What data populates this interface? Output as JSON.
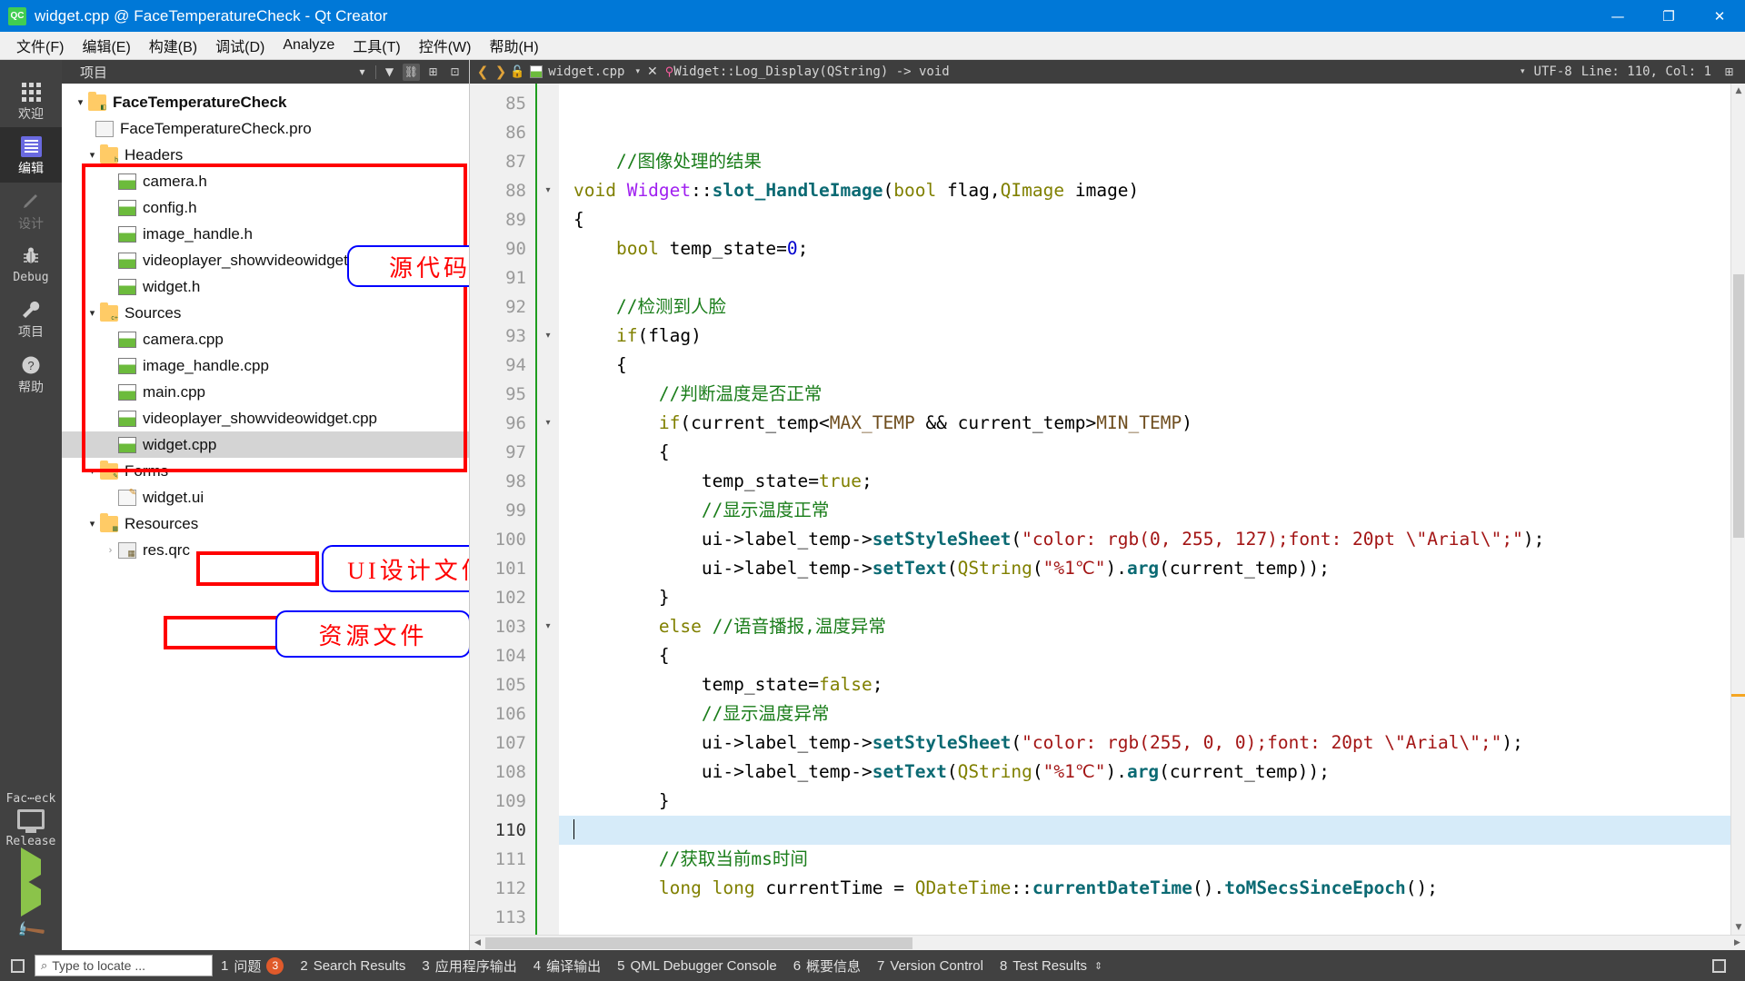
{
  "window": {
    "app_icon": "qt-creator-icon",
    "title": "widget.cpp @ FaceTemperatureCheck - Qt Creator",
    "minimize": "—",
    "maximize": "❐",
    "close": "✕"
  },
  "menubar": {
    "items": [
      {
        "label": "文件(F)",
        "name": "menu-file"
      },
      {
        "label": "编辑(E)",
        "name": "menu-edit"
      },
      {
        "label": "构建(B)",
        "name": "menu-build"
      },
      {
        "label": "调试(D)",
        "name": "menu-debug"
      },
      {
        "label": "Analyze",
        "name": "menu-analyze"
      },
      {
        "label": "工具(T)",
        "name": "menu-tools"
      },
      {
        "label": "控件(W)",
        "name": "menu-window"
      },
      {
        "label": "帮助(H)",
        "name": "menu-help"
      }
    ]
  },
  "modebar": {
    "modes": [
      {
        "label": "欢迎",
        "icon": "grid-icon",
        "state": "normal"
      },
      {
        "label": "编辑",
        "icon": "document-lines-icon",
        "state": "active"
      },
      {
        "label": "设计",
        "icon": "pencil-icon",
        "state": "disabled"
      },
      {
        "label": "Debug",
        "icon": "bug-icon",
        "state": "normal"
      },
      {
        "label": "项目",
        "icon": "wrench-icon",
        "state": "normal"
      },
      {
        "label": "帮助",
        "icon": "question-circle-icon",
        "state": "normal"
      }
    ],
    "kit": {
      "project": "Fac⋯eck",
      "build_config": "Release",
      "run_icon": "play-icon",
      "debug_icon": "play-debug-icon",
      "build_icon": "hammer-icon"
    }
  },
  "sidebar": {
    "header": {
      "title": "项目",
      "filter_caret": "▾",
      "filter_icon": "filter-icon",
      "link_icon": "link-icon",
      "split_icon": "split-icon",
      "close_icon": "close-panel-icon"
    },
    "tree": [
      {
        "label": "FaceTemperatureCheck",
        "icon": "project-folder-icon",
        "arrow": "▾",
        "indent": 0,
        "bold": true,
        "selected": false
      },
      {
        "label": "FaceTemperatureCheck.pro",
        "icon": "pro-file-icon",
        "arrow": "",
        "indent": 1,
        "bold": false,
        "selected": false
      },
      {
        "label": "Headers",
        "icon": "folder-headers-icon",
        "arrow": "▾",
        "indent": 1,
        "bold": false,
        "selected": false
      },
      {
        "label": "camera.h",
        "icon": "source-file-icon",
        "arrow": "",
        "indent": 2,
        "bold": false,
        "selected": false
      },
      {
        "label": "config.h",
        "icon": "source-file-icon",
        "arrow": "",
        "indent": 2,
        "bold": false,
        "selected": false
      },
      {
        "label": "image_handle.h",
        "icon": "source-file-icon",
        "arrow": "",
        "indent": 2,
        "bold": false,
        "selected": false
      },
      {
        "label": "videoplayer_showvideowidget.h",
        "icon": "source-file-icon",
        "arrow": "",
        "indent": 2,
        "bold": false,
        "selected": false
      },
      {
        "label": "widget.h",
        "icon": "source-file-icon",
        "arrow": "",
        "indent": 2,
        "bold": false,
        "selected": false
      },
      {
        "label": "Sources",
        "icon": "folder-sources-icon",
        "arrow": "▾",
        "indent": 1,
        "bold": false,
        "selected": false
      },
      {
        "label": "camera.cpp",
        "icon": "source-file-icon",
        "arrow": "",
        "indent": 2,
        "bold": false,
        "selected": false
      },
      {
        "label": "image_handle.cpp",
        "icon": "source-file-icon",
        "arrow": "",
        "indent": 2,
        "bold": false,
        "selected": false
      },
      {
        "label": "main.cpp",
        "icon": "source-file-icon",
        "arrow": "",
        "indent": 2,
        "bold": false,
        "selected": false
      },
      {
        "label": "videoplayer_showvideowidget.cpp",
        "icon": "source-file-icon",
        "arrow": "",
        "indent": 2,
        "bold": false,
        "selected": false
      },
      {
        "label": "widget.cpp",
        "icon": "source-file-icon",
        "arrow": "",
        "indent": 2,
        "bold": false,
        "selected": true
      },
      {
        "label": "Forms",
        "icon": "folder-forms-icon",
        "arrow": "▾",
        "indent": 1,
        "bold": false,
        "selected": false
      },
      {
        "label": "widget.ui",
        "icon": "ui-file-icon",
        "arrow": "",
        "indent": 2,
        "bold": false,
        "selected": false
      },
      {
        "label": "Resources",
        "icon": "folder-resources-icon",
        "arrow": "▾",
        "indent": 1,
        "bold": false,
        "selected": false
      },
      {
        "label": "res.qrc",
        "icon": "qrc-file-icon",
        "arrow": "›",
        "indent": 2,
        "bold": false,
        "selected": false
      }
    ],
    "annotations": [
      {
        "text": "源代码",
        "name": "annotation-source-code"
      },
      {
        "text": "UI设计文件",
        "name": "annotation-ui-design-file"
      },
      {
        "text": "资源文件",
        "name": "annotation-resource-file"
      }
    ]
  },
  "editor": {
    "nav_back": "❮",
    "nav_forward": "❯",
    "lock_icon": "lock-icon",
    "file_icon": "cpp-file-icon",
    "filename": "widget.cpp",
    "file_caret": "▾",
    "close_label": "✕",
    "symbol_icon": "symbol-pin-icon",
    "symbol": "Widget::Log_Display(QString) -> void",
    "symbol_caret": "▾",
    "encoding": "UTF-8",
    "line_col": "Line: 110, Col: 1",
    "split_icon": "split-editor-icon",
    "first_line": 85,
    "cursor_line": 110,
    "lines": [
      {
        "n": 85,
        "fold": "",
        "tokens": []
      },
      {
        "n": 86,
        "fold": "",
        "tokens": []
      },
      {
        "n": 87,
        "fold": "",
        "tokens": [
          {
            "t": "    ",
            "c": "k-op"
          },
          {
            "t": "//图像处理的结果",
            "c": "k-cmt"
          }
        ]
      },
      {
        "n": 88,
        "fold": "▾",
        "tokens": [
          {
            "t": "void ",
            "c": "k-key"
          },
          {
            "t": "Widget",
            "c": "k-cls"
          },
          {
            "t": "::",
            "c": "k-op"
          },
          {
            "t": "slot_HandleImage",
            "c": "k-fn"
          },
          {
            "t": "(",
            "c": "k-op"
          },
          {
            "t": "bool",
            "c": "k-key"
          },
          {
            "t": " flag,",
            "c": "k-op"
          },
          {
            "t": "QImage",
            "c": "k-key"
          },
          {
            "t": " image)",
            "c": "k-op"
          }
        ]
      },
      {
        "n": 89,
        "fold": "",
        "tokens": [
          {
            "t": "{",
            "c": "k-op"
          }
        ]
      },
      {
        "n": 90,
        "fold": "",
        "tokens": [
          {
            "t": "    ",
            "c": "k-op"
          },
          {
            "t": "bool",
            "c": "k-key"
          },
          {
            "t": " temp_state=",
            "c": "k-op"
          },
          {
            "t": "0",
            "c": "k-num"
          },
          {
            "t": ";",
            "c": "k-op"
          }
        ]
      },
      {
        "n": 91,
        "fold": "",
        "tokens": []
      },
      {
        "n": 92,
        "fold": "",
        "tokens": [
          {
            "t": "    ",
            "c": "k-op"
          },
          {
            "t": "//检测到人脸",
            "c": "k-cmt"
          }
        ]
      },
      {
        "n": 93,
        "fold": "▾",
        "tokens": [
          {
            "t": "    ",
            "c": "k-op"
          },
          {
            "t": "if",
            "c": "k-key"
          },
          {
            "t": "(flag)",
            "c": "k-op"
          }
        ]
      },
      {
        "n": 94,
        "fold": "",
        "tokens": [
          {
            "t": "    {",
            "c": "k-op"
          }
        ]
      },
      {
        "n": 95,
        "fold": "",
        "tokens": [
          {
            "t": "        ",
            "c": "k-op"
          },
          {
            "t": "//判断温度是否正常",
            "c": "k-cmt"
          }
        ]
      },
      {
        "n": 96,
        "fold": "▾",
        "tokens": [
          {
            "t": "        ",
            "c": "k-op"
          },
          {
            "t": "if",
            "c": "k-key"
          },
          {
            "t": "(current_temp<",
            "c": "k-op"
          },
          {
            "t": "MAX_TEMP",
            "c": "k-mac"
          },
          {
            "t": " && current_temp>",
            "c": "k-op"
          },
          {
            "t": "MIN_TEMP",
            "c": "k-mac"
          },
          {
            "t": ")",
            "c": "k-op"
          }
        ]
      },
      {
        "n": 97,
        "fold": "",
        "tokens": [
          {
            "t": "        {",
            "c": "k-op"
          }
        ]
      },
      {
        "n": 98,
        "fold": "",
        "tokens": [
          {
            "t": "            temp_state=",
            "c": "k-op"
          },
          {
            "t": "true",
            "c": "k-key"
          },
          {
            "t": ";",
            "c": "k-op"
          }
        ]
      },
      {
        "n": 99,
        "fold": "",
        "tokens": [
          {
            "t": "            ",
            "c": "k-op"
          },
          {
            "t": "//显示温度正常",
            "c": "k-cmt"
          }
        ]
      },
      {
        "n": 100,
        "fold": "",
        "tokens": [
          {
            "t": "            ui->label_temp->",
            "c": "k-op"
          },
          {
            "t": "setStyleSheet",
            "c": "k-fn"
          },
          {
            "t": "(",
            "c": "k-op"
          },
          {
            "t": "\"color: rgb(0, 255, 127);font: 20pt \\\"Arial\\\";\"",
            "c": "k-str"
          },
          {
            "t": ");",
            "c": "k-op"
          }
        ]
      },
      {
        "n": 101,
        "fold": "",
        "tokens": [
          {
            "t": "            ui->label_temp->",
            "c": "k-op"
          },
          {
            "t": "setText",
            "c": "k-fn"
          },
          {
            "t": "(",
            "c": "k-op"
          },
          {
            "t": "QString",
            "c": "k-key"
          },
          {
            "t": "(",
            "c": "k-op"
          },
          {
            "t": "\"%1℃\"",
            "c": "k-str"
          },
          {
            "t": ").",
            "c": "k-op"
          },
          {
            "t": "arg",
            "c": "k-fn"
          },
          {
            "t": "(current_temp));",
            "c": "k-op"
          }
        ]
      },
      {
        "n": 102,
        "fold": "",
        "tokens": [
          {
            "t": "        }",
            "c": "k-op"
          }
        ]
      },
      {
        "n": 103,
        "fold": "▾",
        "tokens": [
          {
            "t": "        ",
            "c": "k-op"
          },
          {
            "t": "else",
            "c": "k-key"
          },
          {
            "t": " ",
            "c": "k-op"
          },
          {
            "t": "//语音播报,温度异常",
            "c": "k-cmt"
          }
        ]
      },
      {
        "n": 104,
        "fold": "",
        "tokens": [
          {
            "t": "        {",
            "c": "k-op"
          }
        ]
      },
      {
        "n": 105,
        "fold": "",
        "tokens": [
          {
            "t": "            temp_state=",
            "c": "k-op"
          },
          {
            "t": "false",
            "c": "k-key"
          },
          {
            "t": ";",
            "c": "k-op"
          }
        ]
      },
      {
        "n": 106,
        "fold": "",
        "tokens": [
          {
            "t": "            ",
            "c": "k-op"
          },
          {
            "t": "//显示温度异常",
            "c": "k-cmt"
          }
        ]
      },
      {
        "n": 107,
        "fold": "",
        "tokens": [
          {
            "t": "            ui->label_temp->",
            "c": "k-op"
          },
          {
            "t": "setStyleSheet",
            "c": "k-fn"
          },
          {
            "t": "(",
            "c": "k-op"
          },
          {
            "t": "\"color: rgb(255, 0, 0);font: 20pt \\\"Arial\\\";\"",
            "c": "k-str"
          },
          {
            "t": ");",
            "c": "k-op"
          }
        ]
      },
      {
        "n": 108,
        "fold": "",
        "tokens": [
          {
            "t": "            ui->label_temp->",
            "c": "k-op"
          },
          {
            "t": "setText",
            "c": "k-fn"
          },
          {
            "t": "(",
            "c": "k-op"
          },
          {
            "t": "QString",
            "c": "k-key"
          },
          {
            "t": "(",
            "c": "k-op"
          },
          {
            "t": "\"%1℃\"",
            "c": "k-str"
          },
          {
            "t": ").",
            "c": "k-op"
          },
          {
            "t": "arg",
            "c": "k-fn"
          },
          {
            "t": "(current_temp));",
            "c": "k-op"
          }
        ]
      },
      {
        "n": 109,
        "fold": "",
        "tokens": [
          {
            "t": "        }",
            "c": "k-op"
          }
        ]
      },
      {
        "n": 110,
        "fold": "",
        "tokens": [],
        "current": true
      },
      {
        "n": 111,
        "fold": "",
        "tokens": [
          {
            "t": "        ",
            "c": "k-op"
          },
          {
            "t": "//获取当前ms时间",
            "c": "k-cmt"
          }
        ]
      },
      {
        "n": 112,
        "fold": "",
        "tokens": [
          {
            "t": "        ",
            "c": "k-op"
          },
          {
            "t": "long long",
            "c": "k-key"
          },
          {
            "t": " currentTime = ",
            "c": "k-op"
          },
          {
            "t": "QDateTime",
            "c": "k-key"
          },
          {
            "t": "::",
            "c": "k-op"
          },
          {
            "t": "currentDateTime",
            "c": "k-fn"
          },
          {
            "t": "().",
            "c": "k-op"
          },
          {
            "t": "toMSecsSinceEpoch",
            "c": "k-fn"
          },
          {
            "t": "();",
            "c": "k-op"
          }
        ]
      },
      {
        "n": 113,
        "fold": "",
        "tokens": []
      }
    ]
  },
  "statusbar": {
    "toggle_sidebar_icon": "toggle-sidebar-icon",
    "locator_placeholder": "Type to locate ...",
    "locator_icon": "search-person-icon",
    "items": [
      {
        "num": "1",
        "label": "问题",
        "badge": "3"
      },
      {
        "num": "2",
        "label": "Search Results",
        "badge": ""
      },
      {
        "num": "3",
        "label": "应用程序输出",
        "badge": ""
      },
      {
        "num": "4",
        "label": "编译输出",
        "badge": ""
      },
      {
        "num": "5",
        "label": "QML Debugger Console",
        "badge": ""
      },
      {
        "num": "6",
        "label": "概要信息",
        "badge": ""
      },
      {
        "num": "7",
        "label": "Version Control",
        "badge": ""
      },
      {
        "num": "8",
        "label": "Test Results",
        "badge": ""
      }
    ],
    "updown": "⇕",
    "right_icon": "maximize-output-icon"
  },
  "colors": {
    "titlebar": "#0078d7",
    "accent_green": "#41cd52",
    "annotation_red": "#ff0000",
    "annotation_blue": "#0000ff",
    "selection": "#d6ebf9"
  }
}
